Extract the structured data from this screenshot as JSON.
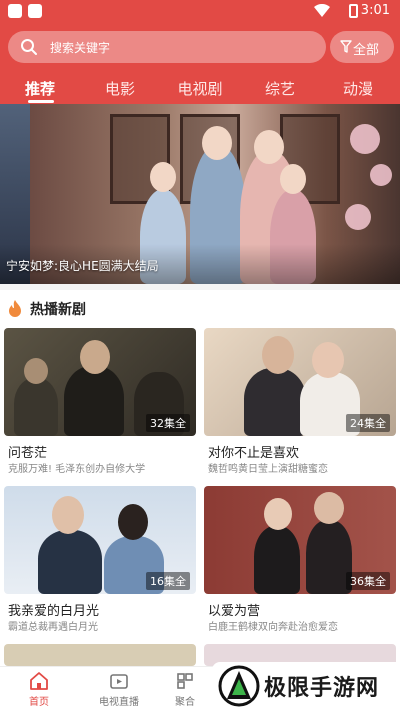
{
  "status_bar": {
    "time": "3:01"
  },
  "search": {
    "placeholder": "搜索关键字"
  },
  "filter": {
    "label": "全部"
  },
  "tabs": [
    {
      "label": "推荐",
      "active": true
    },
    {
      "label": "电影"
    },
    {
      "label": "电视剧"
    },
    {
      "label": "综艺"
    },
    {
      "label": "动漫"
    }
  ],
  "banner": {
    "caption": "宁安如梦:良心HE圆满大结局"
  },
  "section": {
    "title": "热播新剧"
  },
  "cards": [
    {
      "title": "问苍茫",
      "subtitle": "克服万难! 毛泽东创办自修大学",
      "episodes": "32集全"
    },
    {
      "title": "对你不止是喜欢",
      "subtitle": "魏哲鸣黄日莹上演甜糖蜜恋",
      "episodes": "24集全"
    },
    {
      "title": "我亲爱的白月光",
      "subtitle": "霸道总裁再遇白月光",
      "episodes": "16集全"
    },
    {
      "title": "以爱为营",
      "subtitle": "白鹿王鹤棣双向奔赴治愈爱恋",
      "episodes": "36集全"
    }
  ],
  "bottom_nav": [
    {
      "label": "首页",
      "icon": "home-icon",
      "active": true
    },
    {
      "label": "电视直播",
      "icon": "tv-icon"
    },
    {
      "label": "聚合",
      "icon": "aggregate-icon"
    }
  ],
  "watermark": {
    "text": "极限手游网"
  },
  "colors": {
    "accent": "#e24a45",
    "background": "#f4f4f4"
  }
}
